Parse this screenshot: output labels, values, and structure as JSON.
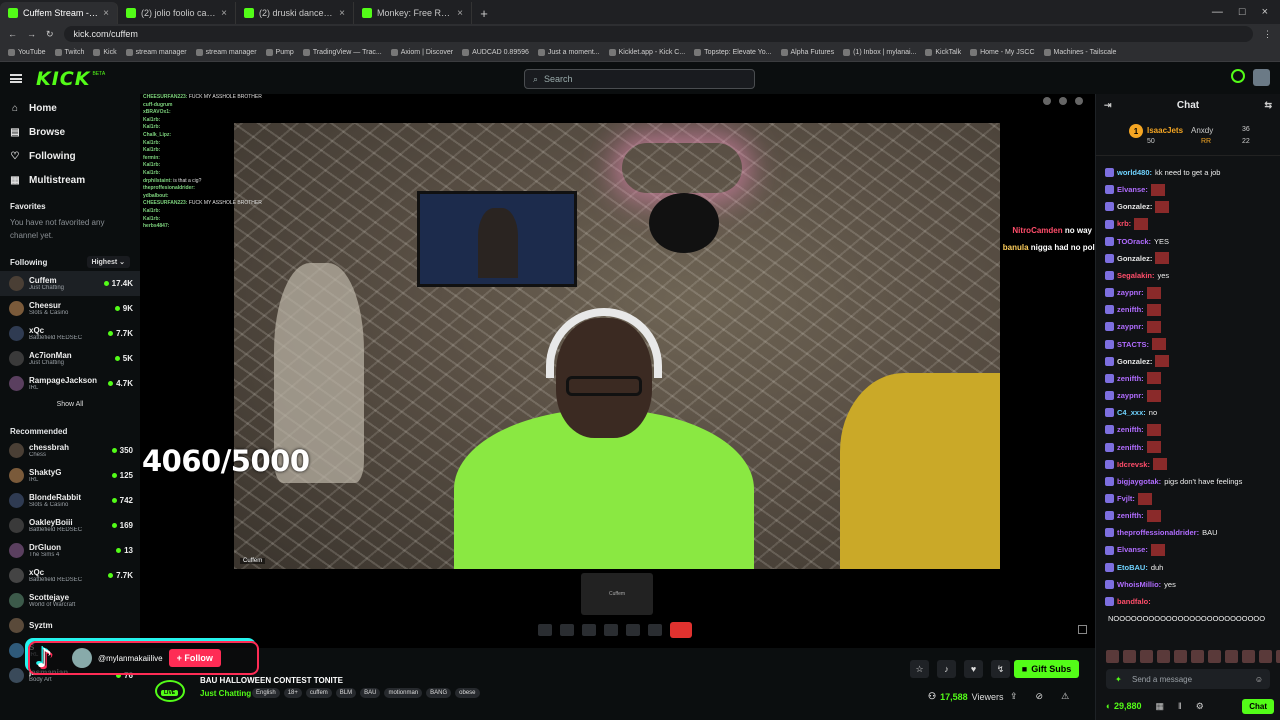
{
  "browser": {
    "tabs": [
      {
        "title": "Cuffem Stream - Watch Live",
        "active": true
      },
      {
        "title": "(2) jolio foolio case day 6 - Search"
      },
      {
        "title": "(2) druski dance - Search / X"
      },
      {
        "title": "Monkey: Free Random Video"
      }
    ],
    "new_tab": "+",
    "url": "kick.com/cuffem",
    "bookmarks": [
      "YouTube",
      "Twitch",
      "Kick",
      "stream manager",
      "stream manager",
      "Pump",
      "TradingView — Trac...",
      "Axiom | Discover",
      "AUDCAD 0.89596",
      "Just a moment...",
      "Kicklet.app - Kick C...",
      "Topstep: Elevate Yo...",
      "Alpha Futures",
      "(1) Inbox | mylanai...",
      "KickTalk",
      "Home - My JSCC",
      "Machines - Tailscale"
    ]
  },
  "topnav": {
    "logo": "KICK",
    "beta": "BETA",
    "search_placeholder": "Search"
  },
  "sidebar": {
    "nav": [
      {
        "label": "Home",
        "icon": "home-icon"
      },
      {
        "label": "Browse",
        "icon": "browse-icon"
      },
      {
        "label": "Following",
        "icon": "heart-icon"
      },
      {
        "label": "Multistream",
        "icon": "multistream-icon"
      }
    ],
    "favorites_heading": "Favorites",
    "favorites_empty": "You have not favorited any channel yet.",
    "following_heading": "Following",
    "sort_label": "Highest",
    "following": [
      {
        "name": "Cuffem",
        "category": "Just Chatting",
        "viewers": "17.4K"
      },
      {
        "name": "Cheesur",
        "category": "Slots & Casino",
        "viewers": "9K"
      },
      {
        "name": "xQc",
        "category": "Battlefield REDSEC",
        "viewers": "7.7K"
      },
      {
        "name": "Ac7ionMan",
        "category": "Just Chatting",
        "viewers": "5K"
      },
      {
        "name": "RampageJackson",
        "category": "IRL",
        "viewers": "4.7K"
      }
    ],
    "show_all": "Show All",
    "recommended_heading": "Recommended",
    "recommended": [
      {
        "name": "chessbrah",
        "category": "Chess",
        "viewers": "350"
      },
      {
        "name": "ShaktyG",
        "category": "IRL",
        "viewers": "125"
      },
      {
        "name": "BlondeRabbit",
        "category": "Slots & Casino",
        "viewers": "742"
      },
      {
        "name": "OakleyBoiii",
        "category": "Battlefield REDSEC",
        "viewers": "169"
      },
      {
        "name": "DrGluon",
        "category": "The Sims 4",
        "viewers": "13"
      },
      {
        "name": "xQc",
        "category": "Battlefield REDSEC",
        "viewers": "7.7K"
      },
      {
        "name": "Scottejaye",
        "category": "World of Warcraft",
        "viewers": ""
      },
      {
        "name": "Syztm",
        "category": "",
        "viewers": ""
      },
      {
        "name": "S",
        "category": "IRL",
        "viewers": ""
      },
      {
        "name": "jasmanian",
        "category": "Body Art",
        "viewers": "76"
      }
    ]
  },
  "stage": {
    "counter": "4060/5000",
    "cam_label": "Cuffem",
    "pip_label": "Cuffem",
    "overlay_chat": [
      {
        "user": "CHEESURFAN223:",
        "text": "FUCK MY ASSHOLE BROTHER"
      },
      {
        "user": "cuff-dugrum",
        "text": ""
      },
      {
        "user": "xBRAVOx1:",
        "text": ""
      },
      {
        "user": "Kal1rb:",
        "text": ""
      },
      {
        "user": "Kal1rb:",
        "text": ""
      },
      {
        "user": "Chalk_Lipz:",
        "text": ""
      },
      {
        "user": "Kal1rb:",
        "text": ""
      },
      {
        "user": "Kal1rb:",
        "text": ""
      },
      {
        "user": "fermin:",
        "text": ""
      },
      {
        "user": "Kal1rb:",
        "text": ""
      },
      {
        "user": "Kal1rb:",
        "text": ""
      },
      {
        "user": "drphilstaint:",
        "text": "is that a cig?"
      },
      {
        "user": "theproffesionaldrider:",
        "text": ""
      },
      {
        "user": "ydbalbout:",
        "text": ""
      },
      {
        "user": "CHEESURFAN223:",
        "text": "FUCK MY ASSHOLE BROTHER"
      },
      {
        "user": "Kal1rb:",
        "text": ""
      },
      {
        "user": "Kal1rb:",
        "text": ""
      },
      {
        "user": "herbs4847:",
        "text": ""
      }
    ],
    "float_msgs": [
      {
        "user": "NitroCamden",
        "text": "no way"
      },
      {
        "user": "banula",
        "text": "nigga had no poll"
      }
    ]
  },
  "tiktok": {
    "handle": "@mylanmakaiilive",
    "follow": "+ Follow"
  },
  "streaminfo": {
    "live": "LIVE",
    "title": "BAU HALLOWEEN CONTEST TONITE",
    "category": "Just Chatting",
    "tags": [
      "English",
      "18+",
      "cuffem",
      "BLM",
      "BAU",
      "motionman",
      "BANG",
      "obese"
    ],
    "gift": "Gift Subs",
    "viewers": "17,588",
    "viewers_label": "Viewers"
  },
  "chat": {
    "title": "Chat",
    "pinned": {
      "user1": "IsaacJets",
      "count1": "50",
      "user2": "Anxdy",
      "count2": "36",
      "user3": "RR",
      "count3": "22",
      "rank": "1"
    },
    "messages": [
      {
        "user": "world480:",
        "text": "kk need to get a job",
        "color": "#6fd3ff"
      },
      {
        "user": "Elvanse:",
        "text": "",
        "color": "#b06cff",
        "emote": true
      },
      {
        "user": "Gonzalez:",
        "text": "",
        "color": "#e6e6e6",
        "emote": true
      },
      {
        "user": "krb:",
        "text": "",
        "color": "#ff4d6a",
        "emote": true
      },
      {
        "user": "TOOrack:",
        "text": "YES",
        "color": "#b06cff"
      },
      {
        "user": "Gonzalez:",
        "text": "",
        "color": "#e6e6e6",
        "emote": true
      },
      {
        "user": "Segalakin:",
        "text": "yes",
        "color": "#ff4d6a"
      },
      {
        "user": "zaypnr:",
        "text": "",
        "color": "#b06cff",
        "emote": true
      },
      {
        "user": "zenifth:",
        "text": "",
        "color": "#b06cff",
        "emote": true
      },
      {
        "user": "zaypnr:",
        "text": "",
        "color": "#b06cff",
        "emote": true
      },
      {
        "user": "STACTS:",
        "text": "",
        "color": "#b06cff",
        "emote": true
      },
      {
        "user": "Gonzalez:",
        "text": "",
        "color": "#e6e6e6",
        "emote": true
      },
      {
        "user": "zenifth:",
        "text": "",
        "color": "#b06cff",
        "emote": true
      },
      {
        "user": "zaypnr:",
        "text": "",
        "color": "#b06cff",
        "emote": true
      },
      {
        "user": "C4_xxx:",
        "text": "no",
        "color": "#6fd3ff"
      },
      {
        "user": "zenifth:",
        "text": "",
        "color": "#b06cff",
        "emote": true
      },
      {
        "user": "zenifth:",
        "text": "",
        "color": "#b06cff",
        "emote": true
      },
      {
        "user": "Idcrevsk:",
        "text": "",
        "color": "#ff4d6a",
        "emote": true
      },
      {
        "user": "bigjaygotak:",
        "text": "pigs don't have feelings",
        "color": "#b06cff"
      },
      {
        "user": "Fvjlt:",
        "text": "",
        "color": "#b06cff",
        "emote": true
      },
      {
        "user": "zenifth:",
        "text": "",
        "color": "#b06cff",
        "emote": true
      },
      {
        "user": "theproffessionaldrider:",
        "text": "BAU",
        "color": "#b06cff"
      },
      {
        "user": "Elvanse:",
        "text": "",
        "color": "#b06cff",
        "emote": true
      },
      {
        "user": "EtoBAU:",
        "text": "duh",
        "color": "#6fd3ff"
      },
      {
        "user": "WhoisMillio:",
        "text": "yes",
        "color": "#b06cff"
      },
      {
        "user": "bandfalo:",
        "text": "",
        "color": "#ff4d6a"
      },
      {
        "user": "",
        "text": "NOOOOOOOOOOOOOOOOOOOOOOOOOO",
        "color": "#eee"
      }
    ],
    "input_placeholder": "Send a message",
    "points": "29,880",
    "chat_button": "Chat"
  }
}
